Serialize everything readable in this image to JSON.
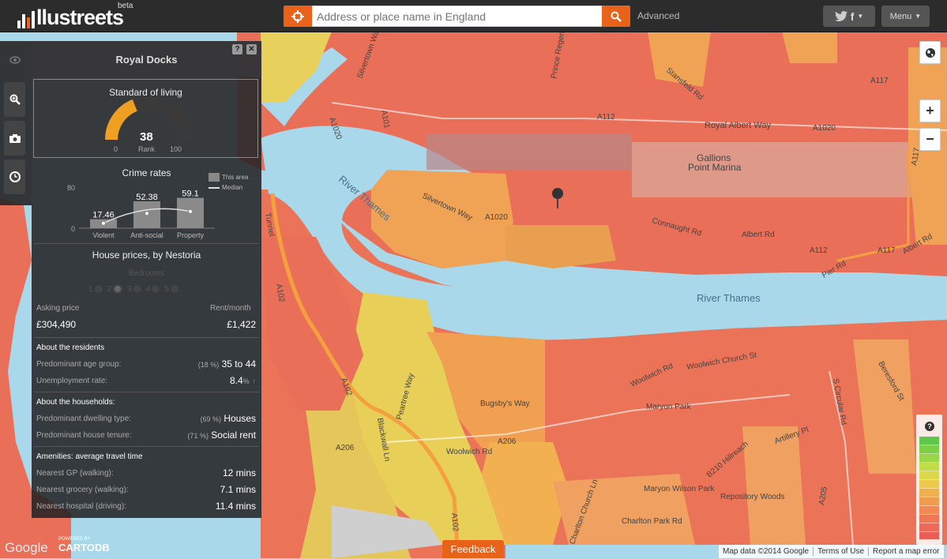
{
  "header": {
    "logo_text": "llustreets",
    "beta": "beta",
    "search_placeholder": "Address or place name in England",
    "advanced_label": "Advanced",
    "social_label": "f",
    "menu_label": "Menu"
  },
  "map_labels": {
    "river_thames_1": "River Thames",
    "river_thames_2": "River Thames",
    "gallions": "Gallions",
    "point_marina": "Point Marina",
    "royal_albert_way": "Royal Albert Way",
    "silvertown_way": "Silvertown Way",
    "a1020_a": "A1020",
    "a1020_b": "A1020",
    "a1020_c": "A1020",
    "a112_a": "A112",
    "a112_b": "A112",
    "a117_a": "A117",
    "a117_b": "A117",
    "a117_c": "A117",
    "connaught_rd": "Connaught Rd",
    "albert_rd_a": "Albert Rd",
    "albert_rd_b": "Albert Rd",
    "pier_rd": "Pier Rd",
    "silvertown_way_top": "Silvertown Way",
    "a101": "A101",
    "a102_a": "A102",
    "a102_b": "A102",
    "a102_c": "A102",
    "a206_a": "A206",
    "a206_b": "A206",
    "a205": "A205",
    "bugsbys_way": "Bugsby's Way",
    "peartree_way": "Peartree Way",
    "woolwich_rd_a": "Woolwich Rd",
    "woolwich_rd_b": "Woolwich Rd",
    "woolwich_church_st": "Woolwich Church St",
    "maryon_park": "Maryon Park",
    "maryon_wilson_park": "Maryon Wilson Park",
    "repository_woods": "Repository Woods",
    "charlton_park_rd": "Charlton Park Rd",
    "charlton_church_ln": "Charlton Church Ln",
    "artillery_pl": "Artillery Pl",
    "b210_hillreach": "B210 Hillreach",
    "beresford_st": "Beresford St",
    "s_circular_rd": "S Circular Rd",
    "blackwall_ln": "Blackwall Ln",
    "prince_regent_ln": "Prince Regent Ln",
    "stansfeld_rd": "Stansfeld Rd",
    "tunnel": "Tunnel"
  },
  "panel": {
    "title": "Royal Docks",
    "help": "?",
    "close": "✕",
    "standard_of_living": {
      "title": "Standard of living",
      "value": "38",
      "rank_label": "Rank",
      "min": "0",
      "max": "100",
      "fraction": 0.38
    },
    "crime": {
      "title": "Crime rates",
      "ymax": "80",
      "ymin": "0",
      "legend_area": "This area",
      "legend_median": "Median",
      "scale_max": 80,
      "bars": [
        {
          "label": "Violent",
          "value": "17.46",
          "num": 17.46
        },
        {
          "label": "Anti-social",
          "value": "52.38",
          "num": 52.38
        },
        {
          "label": "Property",
          "value": "59.1",
          "num": 59.1
        }
      ]
    },
    "house_prices": {
      "title": "House prices, by Nestoria",
      "bedrooms_label": "Bedrooms",
      "bedrooms": [
        "1",
        "2",
        "3",
        "4",
        "5"
      ],
      "asking_label": "Asking price",
      "asking_value": "£304,490",
      "rent_label": "Rent/month",
      "rent_value": "£1,422"
    },
    "residents": {
      "title": "About the residents",
      "age_label": "Predominant age group:",
      "age_pct": "(18 %)",
      "age_value": "35 to 44",
      "unemp_label": "Unemployment rate:",
      "unemp_value": "8.4",
      "unemp_unit": "%"
    },
    "households": {
      "title": "About the households:",
      "dwelling_label": "Predominant dwelling type:",
      "dwelling_pct": "(69 %)",
      "dwelling_value": "Houses",
      "tenure_label": "Predominant house tenure:",
      "tenure_pct": "(71 %)",
      "tenure_value": "Social rent"
    },
    "amenities": {
      "title": "Amenities: average travel time",
      "gp_label": "Nearest GP (walking):",
      "gp_value": "12 mins",
      "grocery_label": "Nearest grocery (walking):",
      "grocery_value": "7.1 mins",
      "hospital_label": "Nearest hospital (driving):",
      "hospital_value": "11.4 mins"
    }
  },
  "controls": {
    "zoom_in": "+",
    "zoom_out": "−",
    "legend_help": "?"
  },
  "footer": {
    "feedback": "Feedback",
    "google": "Google",
    "powered": "POWERED BY",
    "cartodb": "CARTODB",
    "map_data": "Map data ©2014 Google",
    "terms": "Terms of Use",
    "report": "Report a map error"
  },
  "colors": {
    "accent": "#e8621a",
    "water": "#a8d8ea",
    "high": "#ea6a55",
    "mid": "#f0a050",
    "low": "#e7d45a"
  }
}
